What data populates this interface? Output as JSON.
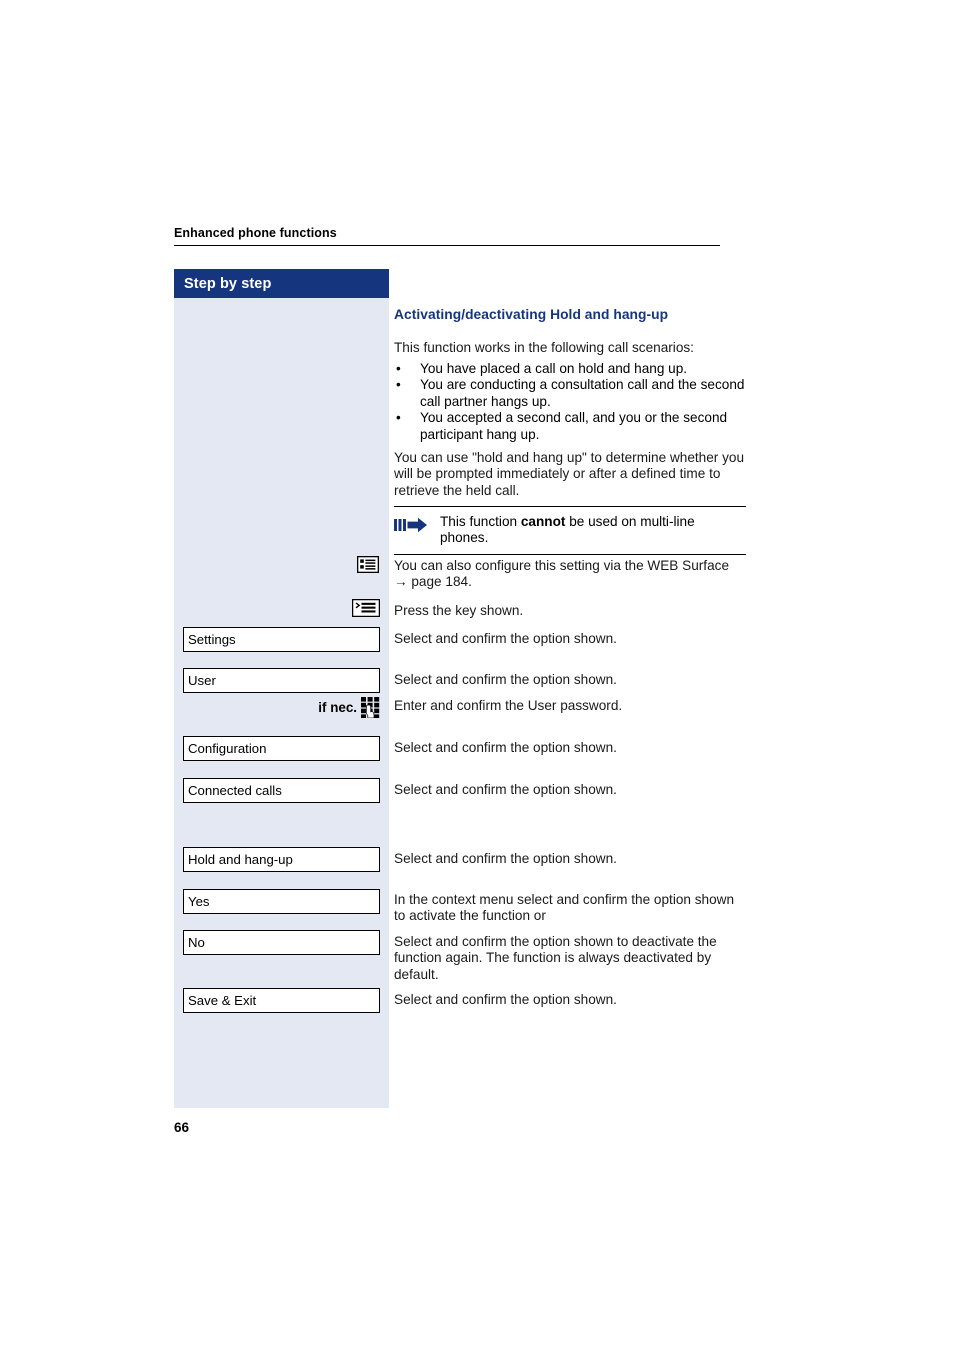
{
  "header": {
    "running_title": "Enhanced phone functions"
  },
  "sidebar": {
    "title": "Step by step",
    "bg_color": "#e4e8f2",
    "title_bar_color": "#15367e",
    "options": [
      {
        "label": "Settings",
        "name": "settings"
      },
      {
        "label": "User",
        "name": "user"
      },
      {
        "label": "Configuration",
        "name": "configuration"
      },
      {
        "label": "Connected calls",
        "name": "connected-calls"
      },
      {
        "label": "Hold and hang-up",
        "name": "hold-and-hang-up"
      },
      {
        "label": "Yes",
        "name": "yes"
      },
      {
        "label": "No",
        "name": "no"
      },
      {
        "label": "Save & Exit",
        "name": "save-and-exit"
      }
    ],
    "if_necessary_label": "if nec."
  },
  "main": {
    "section_title": "Activating/deactivating Hold and hang-up",
    "section_title_color": "#15367e",
    "intro": "This function works in the following call scenarios:",
    "bullet_marker": "•",
    "bullets": [
      "You have placed a call on hold and hang up.",
      "You are conducting a consultation call and the second call partner hangs up.",
      "You accepted a second call, and you or the second participant hang up."
    ],
    "paragraph": "You can use \"hold and hang up\" to determine whether you will be prompted immediately or after a defined time to retrieve the held call.",
    "note": {
      "text_before": "This function ",
      "emphasis": "cannot",
      "text_after": " be used on multi-line phones."
    },
    "web_surface_note": "You can also configure this setting via the WEB Surface",
    "cross_reference_arrow": "→",
    "cross_reference": "page 184.",
    "instructions": [
      "Press the key shown.",
      "Select and confirm the option shown.",
      "Select and confirm the option shown.",
      "Enter and confirm the User password.",
      "Select and confirm the option shown.",
      "Select and confirm the option shown.",
      "Select and confirm the option shown.",
      "In the context menu select and confirm the option shown to activate the function or",
      "Select and confirm the option shown to deactivate the function again. The function is always deactivated by default.",
      "Select and confirm the option shown."
    ]
  },
  "footer": {
    "page_number": "66"
  },
  "icons": {
    "note_arrow": "right-arrow-icon",
    "web_surface": "web-surface-display-icon",
    "menu_key": "menu-key-icon",
    "keypad": "keypad-hand-icon"
  }
}
